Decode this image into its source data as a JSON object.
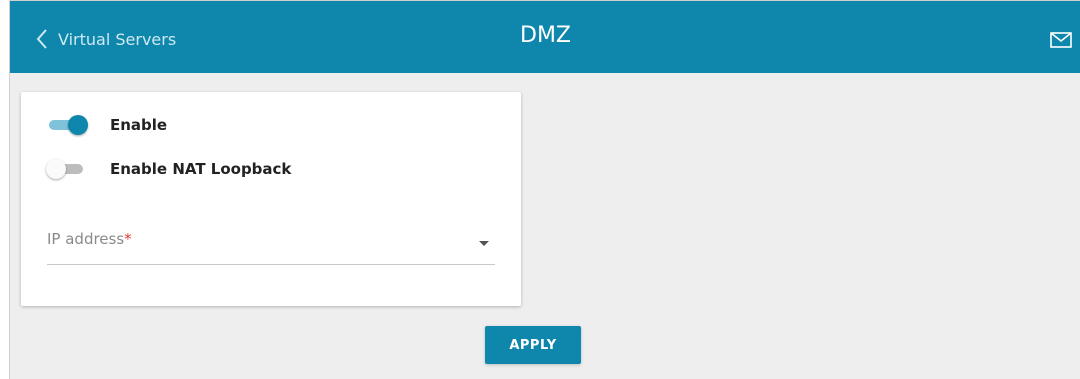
{
  "header": {
    "back_label": "Virtual Servers",
    "title": "DMZ",
    "back_icon": "chevron-left-icon",
    "mail_icon": "mail-icon"
  },
  "form": {
    "enable": {
      "label": "Enable",
      "checked": true
    },
    "nat_loopback": {
      "label": "Enable NAT Loopback",
      "checked": false
    },
    "ip_address": {
      "label": "IP address",
      "required_marker": "*",
      "value": ""
    }
  },
  "actions": {
    "apply_label": "APPLY"
  },
  "colors": {
    "accent": "#0f87ad",
    "background": "#eeeeee",
    "required": "#e53935"
  }
}
